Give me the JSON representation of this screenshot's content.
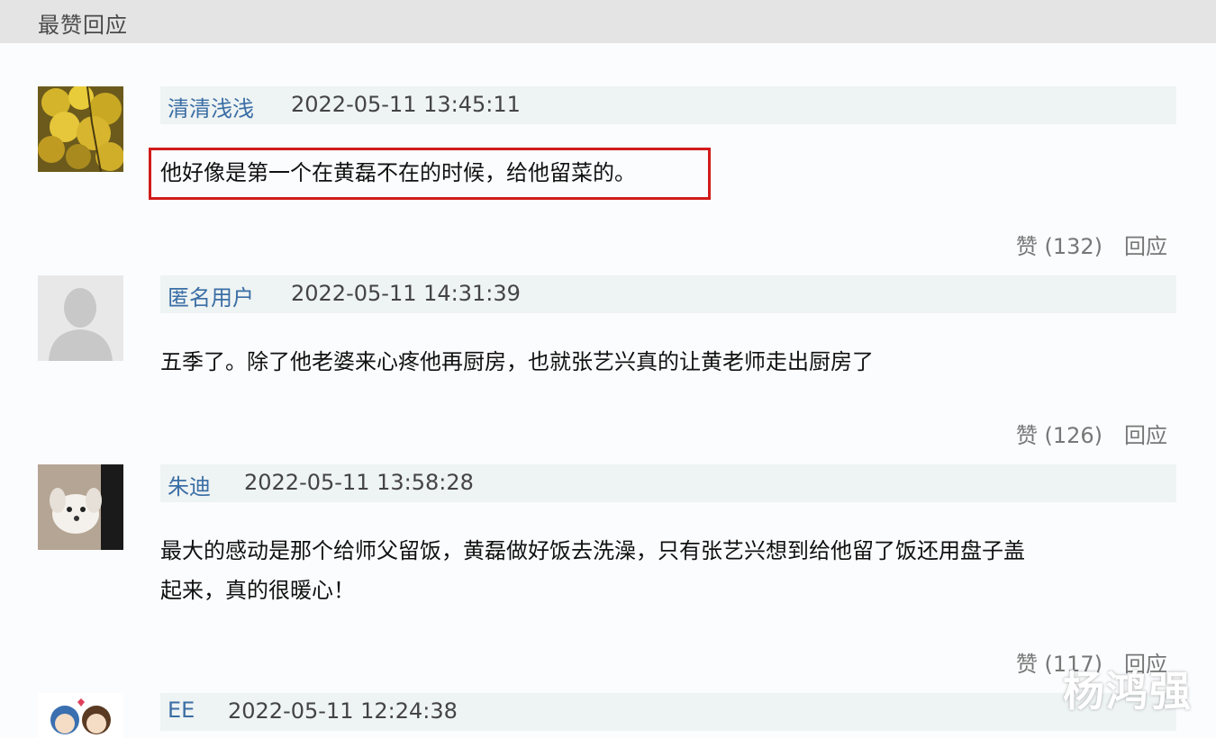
{
  "header": {
    "title": "最赞回应"
  },
  "comments": [
    {
      "user": "清清浅浅",
      "time": "2022-05-11 13:45:11",
      "text": "他好像是第一个在黄磊不在的时候，给他留菜的。",
      "likes": "赞 (132)",
      "reply": "回应",
      "avatar": "yellow-leaves-avatar",
      "highlighted": true
    },
    {
      "user": "匿名用户",
      "time": "2022-05-11 14:31:39",
      "text": "五季了。除了他老婆来心疼他再厨房，也就张艺兴真的让黄老师走出厨房了",
      "likes": "赞 (126)",
      "reply": "回应",
      "avatar": "default-person-avatar"
    },
    {
      "user": "朱迪",
      "time": "2022-05-11 13:58:28",
      "text_line1": "最大的感动是那个给师父留饭，黄磊做好饭去洗澡，只有张艺兴想到给他留了饭还用盘子盖",
      "text_line2": "起来，真的很暖心！",
      "likes": "赞 (117)",
      "reply": "回应",
      "avatar": "puppy-avatar"
    },
    {
      "user": "EE",
      "time": "2022-05-11 12:24:38",
      "avatar": "cartoon-couple-avatar"
    }
  ],
  "watermark": "杨鸿强"
}
